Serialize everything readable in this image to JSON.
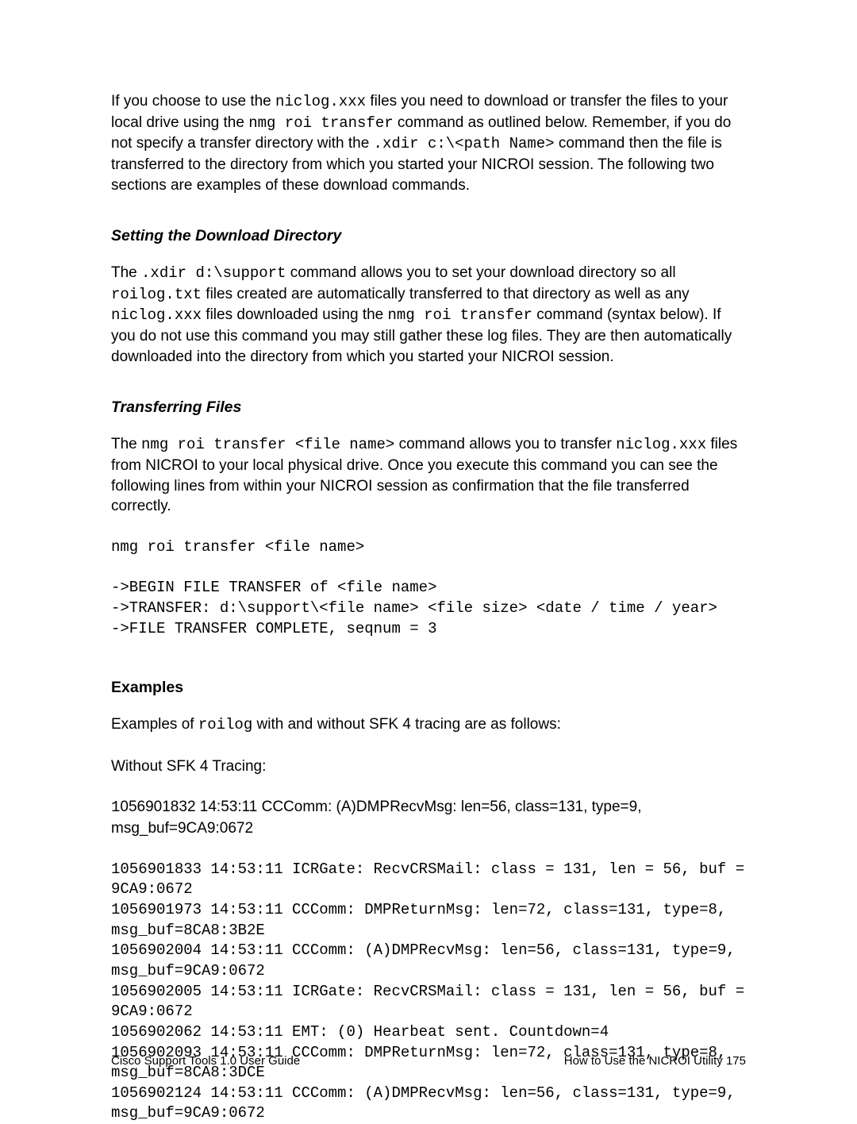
{
  "intro": {
    "line1_a": "If you choose to use the ",
    "line1_mono1": "niclog.xxx",
    "line1_b": " files you need to download or transfer the files to your local drive using the ",
    "line1_mono2": "nmg roi transfer",
    "line1_c": " command as outlined below. Remember, if you do not specify a transfer directory with the ",
    "line1_mono3": ".xdir c:\\<path Name>",
    "line1_d": " command then the file is transferred to the directory from which you started your NICROI session. The following two sections are examples of these download commands."
  },
  "section1": {
    "heading": "Setting the Download Directory",
    "p_a": "The ",
    "p_mono1": ".xdir d:\\support",
    "p_b": " command allows you to set your download directory so all ",
    "p_mono2": "roilog.txt",
    "p_c": " files created are automatically transferred to that directory as well as any ",
    "p_mono3": "niclog.xxx",
    "p_d": " files downloaded using the ",
    "p_mono4": "nmg roi transfer",
    "p_e": " command (syntax below). If you do not use this command you may still gather these log files. They are then automatically downloaded into the directory from which you started your NICROI session."
  },
  "section2": {
    "heading": "Transferring Files",
    "p_a": "The ",
    "p_mono1": "nmg roi transfer <file name>",
    "p_b": " command allows you to transfer ",
    "p_mono2": "niclog.xxx",
    "p_c": " files from NICROI to your local physical drive. Once you execute this command you can see the following lines from within your NICROI session as confirmation that the file transferred correctly.",
    "code": "nmg roi transfer <file name>\n\n->BEGIN FILE TRANSFER of <file name>\n->TRANSFER: d:\\support\\<file name> <file size> <date / time / year>\n->FILE TRANSFER COMPLETE, seqnum = 3"
  },
  "section3": {
    "heading": "Examples",
    "p1_a": "Examples of ",
    "p1_mono": "roilog",
    "p1_b": " with and without SFK 4 tracing are as follows:",
    "p2": "Without SFK 4 Tracing:",
    "p3_mono": "1",
    "p3_rest": "056901832 14:53:11 CCComm: (A)DMPRecvMsg: len=56, class=131, type=9, msg_buf=9CA9:0672",
    "code": "1056901833 14:53:11 ICRGate: RecvCRSMail: class = 131, len = 56, buf =\n9CA9:0672\n1056901973 14:53:11 CCComm: DMPReturnMsg: len=72, class=131, type=8,\nmsg_buf=8CA8:3B2E\n1056902004 14:53:11 CCComm: (A)DMPRecvMsg: len=56, class=131, type=9,\nmsg_buf=9CA9:0672\n1056902005 14:53:11 ICRGate: RecvCRSMail: class = 131, len = 56, buf =\n9CA9:0672\n1056902062 14:53:11 EMT: (0) Hearbeat sent. Countdown=4\n1056902093 14:53:11 CCComm: DMPReturnMsg: len=72, class=131, type=8,\nmsg_buf=8CA8:3DCE\n1056902124 14:53:11 CCComm: (A)DMPRecvMsg: len=56, class=131, type=9,\nmsg_buf=9CA9:0672"
  },
  "footer": {
    "left": "Cisco Support Tools 1.0 User Guide",
    "right": "How to Use the NICROI Utility   175"
  }
}
